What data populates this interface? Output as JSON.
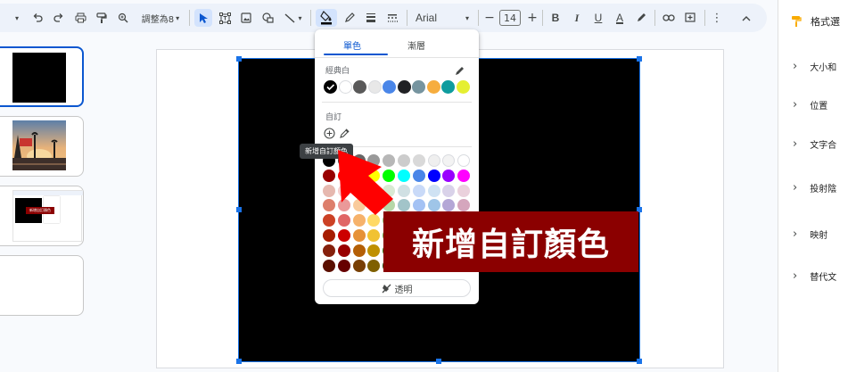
{
  "toolbar": {
    "fit_label": "調整為8",
    "font_name": "Arial",
    "font_size": "14",
    "bold": "B",
    "italic": "I",
    "underline": "U",
    "text_color": "A",
    "accent": "#d3e3fd"
  },
  "popup": {
    "tabs": [
      "單色",
      "漸層"
    ],
    "section_theme": "經典白",
    "section_custom": "自訂",
    "transparent_label": "透明",
    "theme_colors": [
      "#000000",
      "#ffffff",
      "#595959",
      "#e8e8e8",
      "#4a86e8",
      "#202124",
      "#76949f",
      "#f6ad3e",
      "#0e9c9e",
      "#e5ef31"
    ],
    "palette": [
      [
        "#000000",
        "#434343",
        "#666666",
        "#999999",
        "#b7b7b7",
        "#cccccc",
        "#d9d9d9",
        "#efefef",
        "#f3f3f3",
        "#ffffff"
      ],
      [
        "#980000",
        "#ff0000",
        "#ff9900",
        "#ffff00",
        "#00ff00",
        "#00ffff",
        "#4a86e8",
        "#0000ff",
        "#9900ff",
        "#ff00ff"
      ],
      [
        "#e6b8af",
        "#f4cccc",
        "#fce5cd",
        "#fff2cc",
        "#d9ead3",
        "#d0e0e3",
        "#c9daf8",
        "#cfe2f3",
        "#d9d2e9",
        "#ead1dc"
      ],
      [
        "#dd7e6b",
        "#ea9999",
        "#f9cb9c",
        "#ffe599",
        "#b6d7a8",
        "#a2c4c9",
        "#a4c2f4",
        "#9fc5e8",
        "#b4a7d6",
        "#d5a6bd"
      ],
      [
        "#cc4125",
        "#e06666",
        "#f6b26b",
        "#ffd966",
        "#93c47d",
        "#76a5af",
        "#6d9eeb",
        "#6fa8dc",
        "#8e7cc3",
        "#c27ba0"
      ],
      [
        "#a61c00",
        "#cc0000",
        "#e69138",
        "#f1c232",
        "#6aa84f",
        "#45818e",
        "#3c78d8",
        "#3d85c6",
        "#674ea7",
        "#a64d79"
      ],
      [
        "#85200c",
        "#990000",
        "#b45f06",
        "#bf9000",
        "#38761d",
        "#134f5c",
        "#1155cc",
        "#0b5394",
        "#351c75",
        "#741b47"
      ],
      [
        "#5b0f00",
        "#660000",
        "#783f04",
        "#7f6000",
        "#274e13",
        "#0c343d",
        "#1c4587",
        "#073763",
        "#20124d",
        "#4c1130"
      ]
    ]
  },
  "tooltip": "新增自訂顏色",
  "annotation": {
    "text": "新增自訂顏色",
    "color": "#8b0000",
    "arrow_color": "#ff0000"
  },
  "filmstrip": {
    "thumb3_label": "新增自訂顏色"
  },
  "sidepanel": {
    "title": "格式選",
    "items": [
      "大小和",
      "位置",
      "文字合",
      "投射陰",
      "映射",
      "替代文"
    ]
  }
}
